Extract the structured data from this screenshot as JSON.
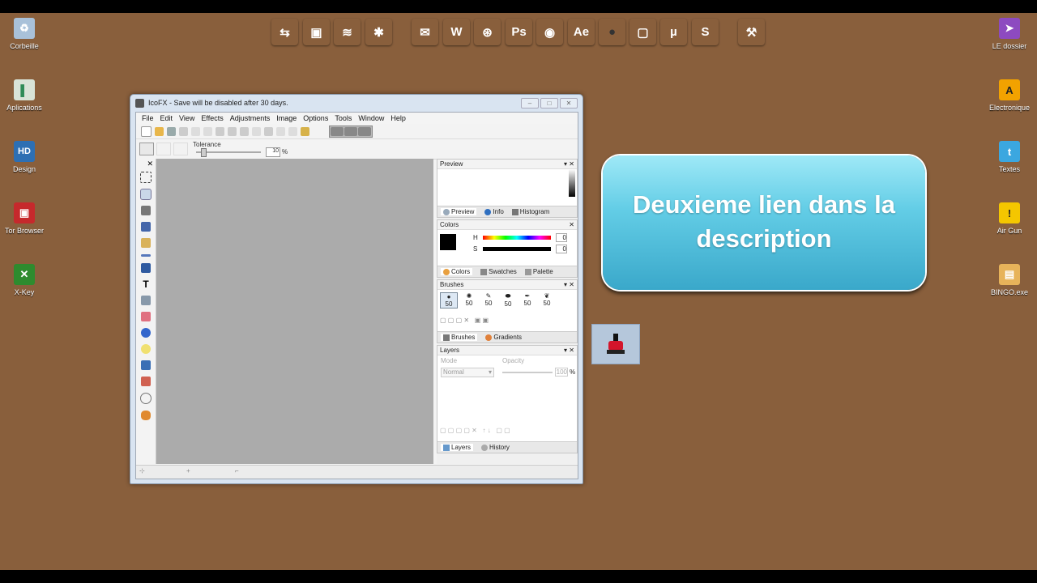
{
  "desktop_left": [
    {
      "label": "Corbeille",
      "icon": "recycle-bin-icon",
      "color": "#a9c1d9"
    },
    {
      "label": "Aplications",
      "icon": "applications-icon",
      "color": "#d8e3d7"
    },
    {
      "label": "Design",
      "icon": "hd-icon",
      "color": "#2d6fb3",
      "glyph": "HD"
    },
    {
      "label": "Tor Browser",
      "icon": "tor-browser-icon",
      "color": "#c6292c"
    },
    {
      "label": "X-Key",
      "icon": "xkey-icon",
      "color": "#2e8b2e",
      "glyph": "✕"
    }
  ],
  "desktop_right": [
    {
      "label": "LE dossier",
      "icon": "purple-folder-icon",
      "color": "#8d4ac0"
    },
    {
      "label": "Electronique",
      "icon": "electronics-icon",
      "color": "#f2a200",
      "glyph": "A"
    },
    {
      "label": "Textes",
      "icon": "twitter-icon",
      "color": "#3ba7e0",
      "glyph": "t"
    },
    {
      "label": "Air Gun",
      "icon": "warning-icon",
      "color": "#f4c600",
      "glyph": "!"
    },
    {
      "label": "BINGO.exe",
      "icon": "bingo-icon",
      "color": "#e7b35a"
    }
  ],
  "dock": [
    {
      "icon": "usb-icon",
      "color": "#7fbcec",
      "glyph": "⇆"
    },
    {
      "icon": "toolbox-red-icon",
      "color": "#d83b3b",
      "glyph": "▣"
    },
    {
      "icon": "rss-icon",
      "color": "#ef6a1f",
      "glyph": "≋"
    },
    {
      "icon": "settings-yellow-icon",
      "color": "#f9e200",
      "glyph": "✱"
    },
    {
      "icon": "mail-icon",
      "color": "#f08a2a",
      "glyph": "✉"
    },
    {
      "icon": "word-icon",
      "color": "#1f77c9",
      "glyph": "W"
    },
    {
      "icon": "network-icon",
      "color": "#e6c313",
      "glyph": "⊛"
    },
    {
      "icon": "photoshop-icon",
      "color": "#2a8bd6",
      "glyph": "Ps"
    },
    {
      "icon": "globe-icon",
      "color": "#2f8f2f",
      "glyph": "◉"
    },
    {
      "icon": "after-effects-icon",
      "color": "#6b5ab4",
      "glyph": "Ae"
    },
    {
      "icon": "apple-icon",
      "color": "#dcdcdc",
      "glyph": ""
    },
    {
      "icon": "frame-icon",
      "color": "#f0a830",
      "glyph": "▢"
    },
    {
      "icon": "utorrent-icon",
      "color": "#6dbb1f",
      "glyph": "µ"
    },
    {
      "icon": "skype-icon",
      "color": "#1fa3e0",
      "glyph": "S"
    },
    {
      "icon": "tools-icon",
      "color": "#5aa9d8",
      "glyph": "⚒"
    }
  ],
  "window": {
    "title": "IcoFX - Save will be disabled after 30 days.",
    "menus": [
      "File",
      "Edit",
      "View",
      "Effects",
      "Adjustments",
      "Image",
      "Options",
      "Tools",
      "Window",
      "Help"
    ],
    "tolerance_label": "Tolerance",
    "tolerance_value": "10",
    "tolerance_unit": "%",
    "panels": {
      "preview": {
        "title": "Preview",
        "tabs": [
          "Preview",
          "Info",
          "Histogram"
        ]
      },
      "colors": {
        "title": "Colors",
        "h": "H",
        "s": "S",
        "h_val": "0",
        "s_val": "0",
        "tabs": [
          "Colors",
          "Swatches",
          "Palette"
        ]
      },
      "brushes": {
        "title": "Brushes",
        "size": "50",
        "tabs": [
          "Brushes",
          "Gradients"
        ]
      },
      "layers": {
        "title": "Layers",
        "mode_label": "Mode",
        "opacity_label": "Opacity",
        "mode_value": "Normal",
        "opacity_value": "100",
        "opacity_unit": "%",
        "tabs": [
          "Layers",
          "History"
        ]
      }
    }
  },
  "callout": {
    "text": "Deuxieme lien dans la description"
  }
}
